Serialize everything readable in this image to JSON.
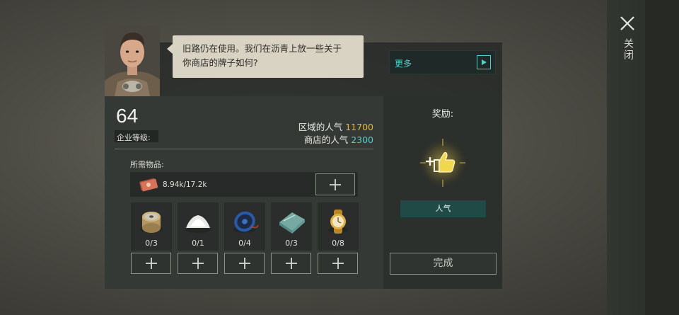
{
  "close": {
    "icon": "close-icon",
    "label": "关闭"
  },
  "dialog": {
    "text_line1": "旧路仍在使用。我们在沥青上放一些关于",
    "text_line2": "你商店的牌子如何?"
  },
  "more_button": {
    "label": "更多",
    "icon": "play-icon"
  },
  "level": {
    "value": "64",
    "label": "企业等级:"
  },
  "popularity": {
    "region_label": "区域的人气",
    "region_value": "11700",
    "shop_label": "商店的人气",
    "shop_value": "2300"
  },
  "requirements": {
    "label": "所需物品:",
    "money": {
      "icon": "cash-bundle-icon",
      "text": "8.94k/17.2k"
    },
    "items": [
      {
        "icon": "wire-spool-icon",
        "count": "0/3"
      },
      {
        "icon": "white-powder-icon",
        "count": "0/1"
      },
      {
        "icon": "cable-reel-icon",
        "count": "0/4"
      },
      {
        "icon": "glass-sheets-icon",
        "count": "0/3"
      },
      {
        "icon": "gold-watch-icon",
        "count": "0/8"
      }
    ]
  },
  "reward": {
    "title": "奖励:",
    "icon": "thumbs-up-icon",
    "tag": "人气",
    "complete_label": "完成"
  },
  "colors": {
    "gold": "#e8b530",
    "teal": "#4fd0c8",
    "reward_tag_bg": "#1f4a46"
  }
}
